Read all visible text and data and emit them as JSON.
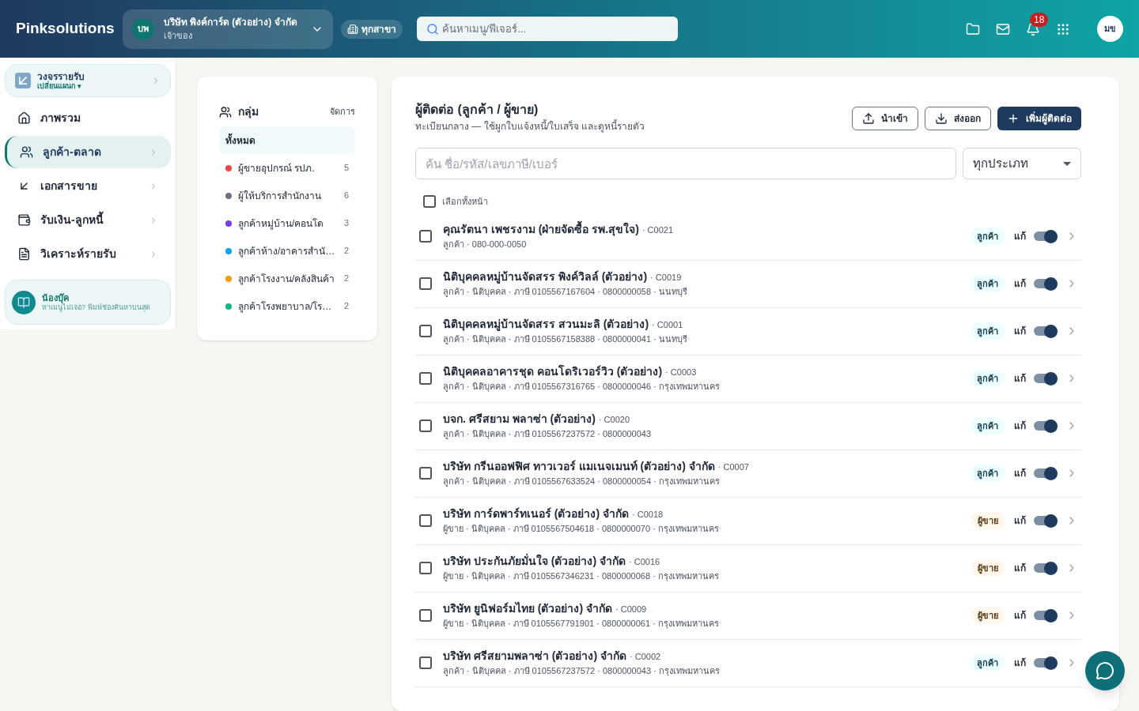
{
  "header": {
    "brand": "Pinksolutions",
    "company": {
      "initials": "บพ",
      "name": "บริษัท พิงค์การ์ด (ตัวอย่าง) จำกัด",
      "role": "เจ้าของ"
    },
    "branch": "ทุกสาขา",
    "search": {
      "placeholder": "ค้นหาเมนู/ฟีเจอร์..."
    },
    "notifications": "18",
    "user_initials": "มข"
  },
  "sidebar": {
    "module": {
      "title": "วงจรรายรับ",
      "switch": "เปลี่ยนแผนก ▾"
    },
    "items": [
      {
        "label": "ภาพรวม",
        "selected": false,
        "has_children": false
      },
      {
        "label": "ลูกค้า-ตลาด",
        "selected": true,
        "has_children": true
      },
      {
        "label": "เอกสารขาย",
        "selected": false,
        "has_children": true
      },
      {
        "label": "รับเงิน-ลูกหนี้",
        "selected": false,
        "has_children": true
      },
      {
        "label": "วิเคราะห์รายรับ",
        "selected": false,
        "has_children": true
      }
    ],
    "helper": {
      "name": "น้องบุ๊ค",
      "hint": "หาเมนูไม่เจอ? พิมพ์ช่องค้นหาบนสุด"
    }
  },
  "groups": {
    "title": "กลุ่ม",
    "manage": "จัดการ",
    "items": [
      {
        "label": "ทั้งหมด",
        "selected": true
      },
      {
        "label": "ผู้ขายอุปกรณ์ รปภ.",
        "count": "5",
        "color": "#ef4444",
        "selected": false
      },
      {
        "label": "ผู้ให้บริการสำนักงาน",
        "count": "6",
        "color": "#6b7280",
        "selected": false
      },
      {
        "label": "ลูกค้าหมู่บ้าน/คอนโด",
        "count": "3",
        "color": "#7c3aed",
        "selected": false
      },
      {
        "label": "ลูกค้าห้าง/อาคารสำนั…",
        "count": "2",
        "color": "#0ea5e9",
        "selected": false
      },
      {
        "label": "ลูกค้าโรงงาน/คลังสินค้า",
        "count": "2",
        "color": "#f59e0b",
        "selected": false
      },
      {
        "label": "ลูกค้าโรงพยาบาล/โร…",
        "count": "2",
        "color": "#10b981",
        "selected": false
      }
    ]
  },
  "contacts": {
    "title": "ผู้ติดต่อ (ลูกค้า / ผู้ขาย)",
    "subtitle": "ทะเบียนกลาง — ใช้ผูกใบแจ้งหนี้/ใบเสร็จ และดูหนี้รายตัว",
    "actions": [
      {
        "label": "นำเข้า",
        "kind": "import"
      },
      {
        "label": "ส่งออก",
        "kind": "export"
      },
      {
        "label": "เพิ่มผู้ติดต่อ",
        "kind": "add"
      }
    ],
    "search": {
      "placeholder": "ค้น ชื่อ/รหัส/เลขภาษี/เบอร์"
    },
    "type_filter": "ทุกประเภท",
    "select_all": {
      "label": "เลือกทั้งหน้า",
      "checked": false
    },
    "rows": [
      {
        "name": "คุณรัตนา เพชรงาม (ฝ่ายจัดซื้อ รพ.สุขใจ)",
        "code": "· C0021",
        "details": "ลูกค้า · 080-000-0050",
        "tag": "ลูกค้า",
        "kind": "customer",
        "edit": "แก้",
        "active": true,
        "checked": false
      },
      {
        "name": "นิติบุคคลหมู่บ้านจัดสรร พิงค์วิลล์ (ตัวอย่าง)",
        "code": "· C0019",
        "details": "ลูกค้า · นิติบุคคล · ภาษี 0105567167604 · 0800000058 · นนทบุรี",
        "tag": "ลูกค้า",
        "kind": "customer",
        "edit": "แก้",
        "active": true,
        "checked": false
      },
      {
        "name": "นิติบุคคลหมู่บ้านจัดสรร สวนมะลิ (ตัวอย่าง)",
        "code": "· C0001",
        "details": "ลูกค้า · นิติบุคคล · ภาษี 0105567158388 · 0800000041 · นนทบุรี",
        "tag": "ลูกค้า",
        "kind": "customer",
        "edit": "แก้",
        "active": true,
        "checked": false
      },
      {
        "name": "นิติบุคคลอาคารชุด คอนโดริเวอร์วิว (ตัวอย่าง)",
        "code": "· C0003",
        "details": "ลูกค้า · นิติบุคคล · ภาษี 0105567316765 · 0800000046 · กรุงเทพมหานคร",
        "tag": "ลูกค้า",
        "kind": "customer",
        "edit": "แก้",
        "active": true,
        "checked": false
      },
      {
        "name": "บจก. ศรีสยาม พลาซ่า (ตัวอย่าง)",
        "code": "· C0020",
        "details": "ลูกค้า · นิติบุคคล · ภาษี 0105567237572 · 0800000043",
        "tag": "ลูกค้า",
        "kind": "customer",
        "edit": "แก้",
        "active": true,
        "checked": false
      },
      {
        "name": "บริษัท กรีนออฟฟิศ ทาวเวอร์ แมเนจเมนท์ (ตัวอย่าง) จำกัด",
        "code": "· C0007",
        "details": "ลูกค้า · นิติบุคคล · ภาษี 0105567633524 · 0800000054 · กรุงเทพมหานคร",
        "tag": "ลูกค้า",
        "kind": "customer",
        "edit": "แก้",
        "active": true,
        "checked": false
      },
      {
        "name": "บริษัท การ์ดพาร์ทเนอร์ (ตัวอย่าง) จำกัด",
        "code": "· C0018",
        "details": "ผู้ขาย · นิติบุคคล · ภาษี 0105567504618 · 0800000070 · กรุงเทพมหานคร",
        "tag": "ผู้ขาย",
        "kind": "vendor",
        "edit": "แก้",
        "active": true,
        "checked": false
      },
      {
        "name": "บริษัท ประกันภัยมั่นใจ (ตัวอย่าง) จำกัด",
        "code": "· C0016",
        "details": "ผู้ขาย · นิติบุคคล · ภาษี 0105567346231 · 0800000068 · กรุงเทพมหานคร",
        "tag": "ผู้ขาย",
        "kind": "vendor",
        "edit": "แก้",
        "active": true,
        "checked": false
      },
      {
        "name": "บริษัท ยูนิฟอร์มไทย (ตัวอย่าง) จำกัด",
        "code": "· C0009",
        "details": "ผู้ขาย · นิติบุคคล · ภาษี 0105567791901 · 0800000061 · กรุงเทพมหานคร",
        "tag": "ผู้ขาย",
        "kind": "vendor",
        "edit": "แก้",
        "active": true,
        "checked": false
      },
      {
        "name": "บริษัท ศรีสยามพลาซ่า (ตัวอย่าง) จำกัด",
        "code": "· C0002",
        "details": "ลูกค้า · นิติบุคคล · ภาษี 0105567237572 · 0800000043 · กรุงเทพมหานคร",
        "tag": "ลูกค้า",
        "kind": "customer",
        "edit": "แก้",
        "active": true,
        "checked": false
      }
    ]
  }
}
